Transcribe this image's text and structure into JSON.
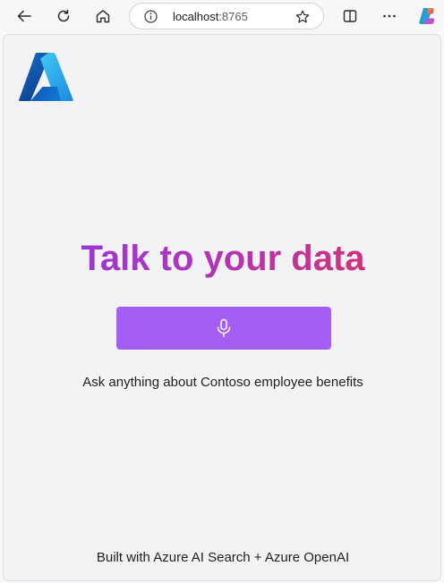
{
  "browser": {
    "url_host": "localhost",
    "url_port": ":8765",
    "icons": [
      "back-arrow-icon",
      "refresh-icon",
      "home-icon",
      "info-icon",
      "star-icon",
      "split-screen-icon",
      "more-icon",
      "copilot-icon"
    ]
  },
  "page": {
    "logo": "azure-logo",
    "headline": "Talk to your data",
    "mic_button_icon": "microphone-icon",
    "prompt": "Ask anything about Contoso employee benefits",
    "footer": "Built with Azure AI Search + Azure OpenAI"
  },
  "colors": {
    "accent_button": "#a55ef3",
    "headline_gradient_start": "#9b37d6",
    "headline_gradient_end": "#d0317a",
    "page_background": "#f3f3f6"
  }
}
